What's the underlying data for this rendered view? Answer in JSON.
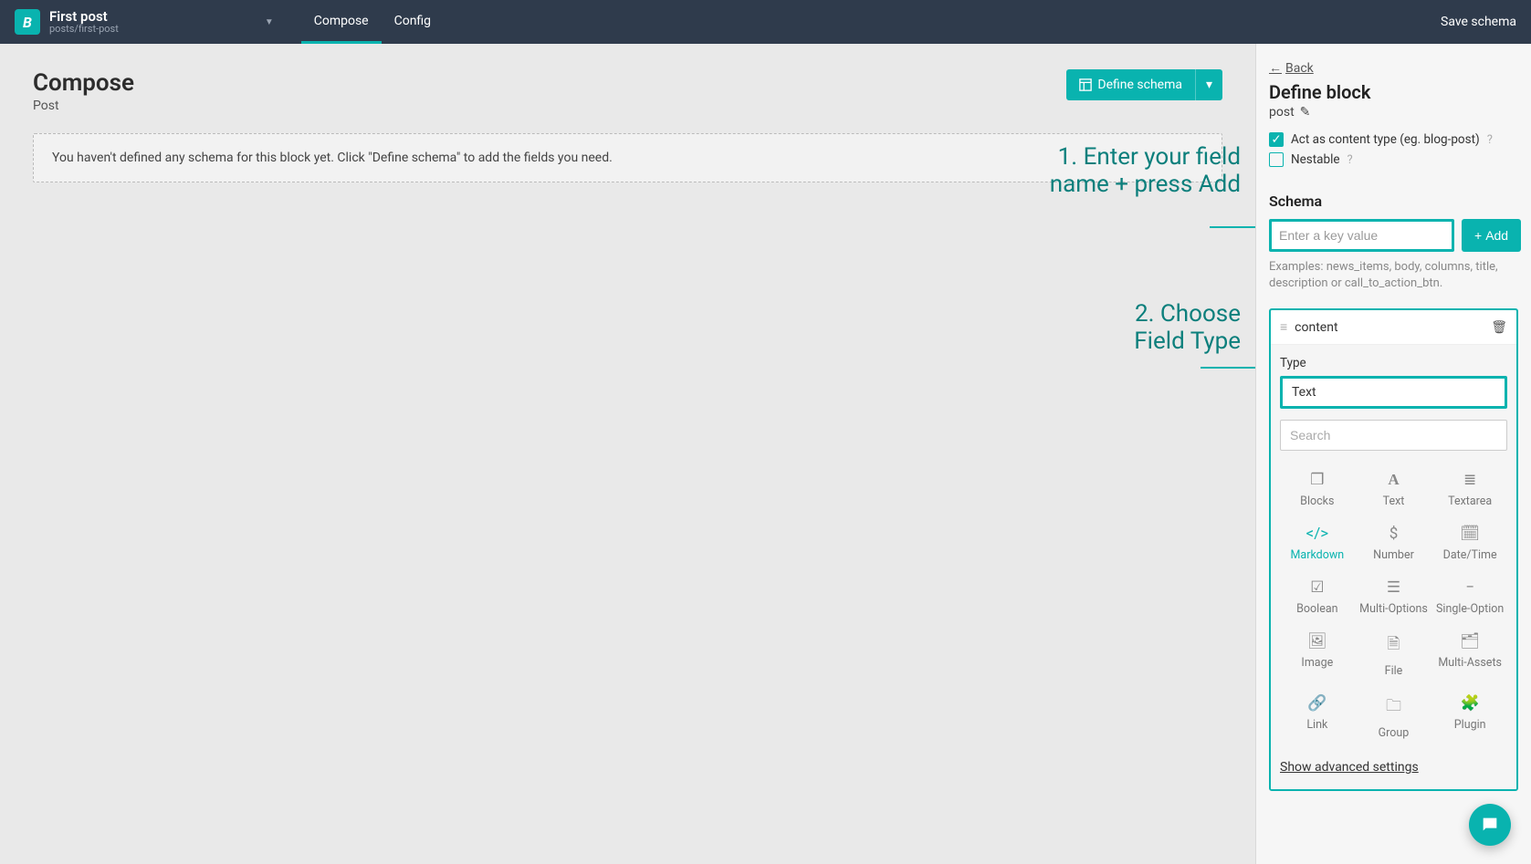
{
  "header": {
    "logo_letter": "B",
    "title": "First post",
    "subtitle": "posts/first-post",
    "tabs": {
      "compose": "Compose",
      "config": "Config"
    },
    "save": "Save schema"
  },
  "main": {
    "compose_title": "Compose",
    "compose_subtitle": "Post",
    "define_schema_btn": "Define schema",
    "empty_message": "You haven't defined any schema for this block yet. Click \"Define schema\" to add the fields you need."
  },
  "sidebar": {
    "back": "Back",
    "define_block": "Define block",
    "block_name": "post",
    "act_as_content": "Act as content type (eg. blog-post)",
    "nestable": "Nestable",
    "schema_label": "Schema",
    "key_placeholder": "Enter a key value",
    "add_btn": "Add",
    "examples": "Examples: news_items, body, columns, title, description or call_to_action_btn.",
    "field_name": "content",
    "type_label": "Type",
    "type_value": "Text",
    "search_placeholder": "Search",
    "types": [
      {
        "label": "Blocks",
        "icon": "cube-icon",
        "glyph": "❒"
      },
      {
        "label": "Text",
        "icon": "text-icon",
        "glyph": "A"
      },
      {
        "label": "Textarea",
        "icon": "textarea-icon",
        "glyph": "≣"
      },
      {
        "label": "Markdown",
        "icon": "code-icon",
        "glyph": "</>",
        "selected": true
      },
      {
        "label": "Number",
        "icon": "number-icon",
        "glyph": "$"
      },
      {
        "label": "Date/Time",
        "icon": "calendar-icon",
        "glyph": "🗓"
      },
      {
        "label": "Boolean",
        "icon": "boolean-icon",
        "glyph": "☑"
      },
      {
        "label": "Multi-Options",
        "icon": "multi-options-icon",
        "glyph": "☰"
      },
      {
        "label": "Single-Option",
        "icon": "single-option-icon",
        "glyph": "−"
      },
      {
        "label": "Image",
        "icon": "image-icon",
        "glyph": "🖼"
      },
      {
        "label": "File",
        "icon": "file-icon",
        "glyph": "🗎"
      },
      {
        "label": "Multi-Assets",
        "icon": "multi-assets-icon",
        "glyph": "🗂"
      },
      {
        "label": "Link",
        "icon": "link-icon",
        "glyph": "🔗"
      },
      {
        "label": "Group",
        "icon": "folder-icon",
        "glyph": "🗀"
      },
      {
        "label": "Plugin",
        "icon": "plugin-icon",
        "glyph": "🧩"
      }
    ],
    "advanced": "Show advanced settings"
  },
  "annotations": {
    "step1": "1. Enter your field name + press Add",
    "step2": "2. Choose Field Type"
  }
}
